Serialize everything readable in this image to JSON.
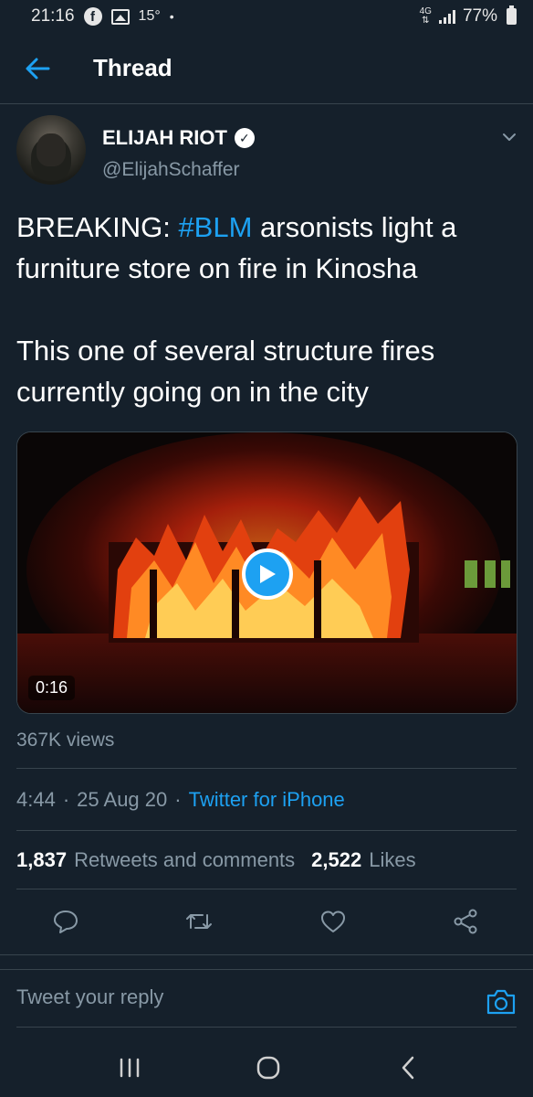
{
  "status_bar": {
    "time": "21:16",
    "temperature": "15°",
    "dot": "•",
    "network": "4G",
    "battery": "77%",
    "icons": [
      "facebook-icon",
      "image-icon",
      "signal-icon",
      "battery-icon"
    ]
  },
  "header": {
    "back_icon": "arrow-left-icon",
    "title": "Thread"
  },
  "tweet": {
    "author_name": "ELIJAH RIOT",
    "author_handle": "@ElijahSchaffer",
    "verified_icon": "verified-badge-icon",
    "text_prefix": "BREAKING: ",
    "hashtag": "#BLM",
    "text_rest": " arsonists light a furniture store on fire in Kinosha\n\nThis one of several structure fires currently going on in the city",
    "video_duration": "0:16",
    "views": "367K views",
    "time": "4:44",
    "separator": "·",
    "date": "25 Aug 20",
    "source": "Twitter for iPhone",
    "retweets_count": "1,837",
    "retweets_label": "Retweets and comments",
    "likes_count": "2,522",
    "likes_label": "Likes"
  },
  "actions": [
    "reply-icon",
    "retweet-icon",
    "like-icon",
    "share-icon"
  ],
  "reply_bar": {
    "placeholder": "Tweet your reply",
    "camera_icon": "camera-icon"
  },
  "nav_bar": [
    "recent-apps-icon",
    "home-icon",
    "back-icon"
  ],
  "colors": {
    "background": "#15202b",
    "accent": "#1da1f2",
    "secondary_text": "#8899a6",
    "divider": "#38444d"
  }
}
